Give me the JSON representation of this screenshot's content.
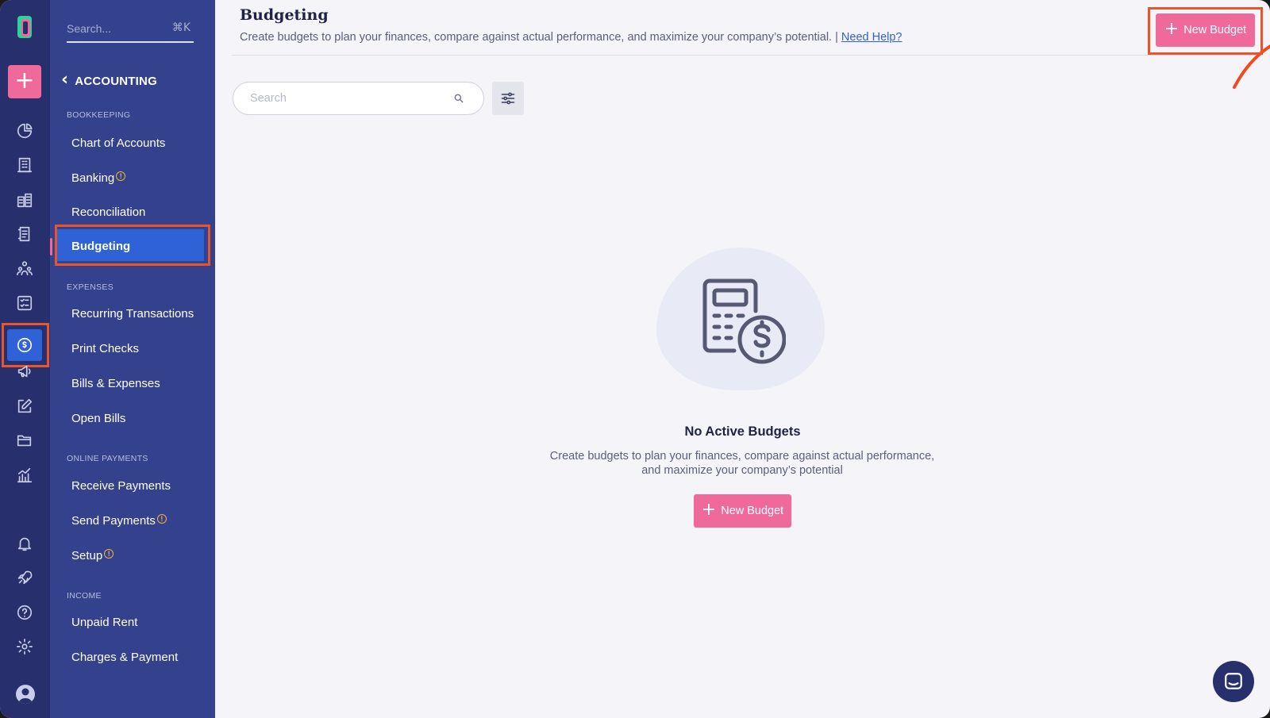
{
  "colors": {
    "rail_bg": "#27306c",
    "submenu_bg": "#34418c",
    "accent_pink": "#ef6a9b",
    "active_blue": "#2e62d6",
    "highlight_orange": "#e9542c",
    "page_bg": "#f4f4f9"
  },
  "rail": {
    "icons": [
      "logo-icon",
      "plus-icon",
      "pie-chart-icon",
      "building-icon",
      "buildings-icon",
      "ledger-icon",
      "people-icon",
      "checklist-icon",
      "dollar-circle-icon",
      "megaphone-icon",
      "edit-icon",
      "folder-icon",
      "bar-chart-icon",
      "bell-icon",
      "rocket-icon",
      "help-icon",
      "gear-icon",
      "avatar-icon"
    ],
    "add_label": "+"
  },
  "submenu": {
    "search_placeholder": "Search...",
    "search_shortcut": "⌘K",
    "back_label": "ACCOUNTING",
    "sections": {
      "bookkeeping": "BOOKKEEPING",
      "expenses": "EXPENSES",
      "online_payments": "ONLINE PAYMENTS",
      "income": "INCOME"
    },
    "items": {
      "chart_of_accounts": "Chart of Accounts",
      "banking": "Banking",
      "reconciliation": "Reconciliation",
      "budgeting": "Budgeting",
      "recurring_transactions": "Recurring Transactions",
      "print_checks": "Print Checks",
      "bills_expenses": "Bills & Expenses",
      "open_bills": "Open Bills",
      "receive_payments": "Receive Payments",
      "send_payments": "Send Payments",
      "setup": "Setup",
      "unpaid_rent": "Unpaid Rent",
      "charges_payment": "Charges & Payment"
    },
    "warning_glyph": "!"
  },
  "header": {
    "title": "Budgeting",
    "subtitle": "Create budgets to plan your finances, compare against actual performance, and maximize your company’s potential. |",
    "help_link": "Need Help?",
    "new_budget_label": "New Budget"
  },
  "toolbar": {
    "search_placeholder": "Search"
  },
  "empty_state": {
    "title": "No Active Budgets",
    "description": "Create budgets to plan your finances, compare against actual performance, and maximize your company’s potential",
    "button_label": "New Budget"
  }
}
